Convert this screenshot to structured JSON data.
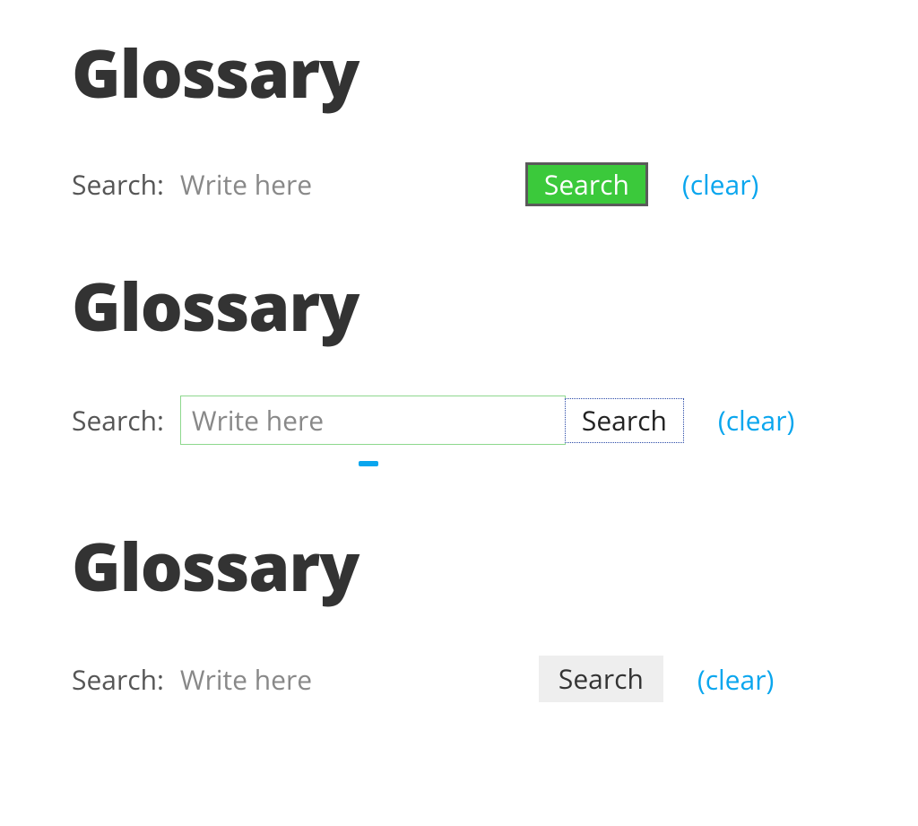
{
  "blocks": [
    {
      "title": "Glossary",
      "search_label": "Search:",
      "placeholder": "Write here",
      "value": "",
      "button_label": "Search",
      "clear_label": "(clear)"
    },
    {
      "title": "Glossary",
      "search_label": "Search:",
      "placeholder": "Write here",
      "value": "",
      "button_label": "Search",
      "clear_label": "(clear)"
    },
    {
      "title": "Glossary",
      "search_label": "Search:",
      "placeholder": "Write here",
      "value": "",
      "button_label": "Search",
      "clear_label": "(clear)"
    }
  ]
}
